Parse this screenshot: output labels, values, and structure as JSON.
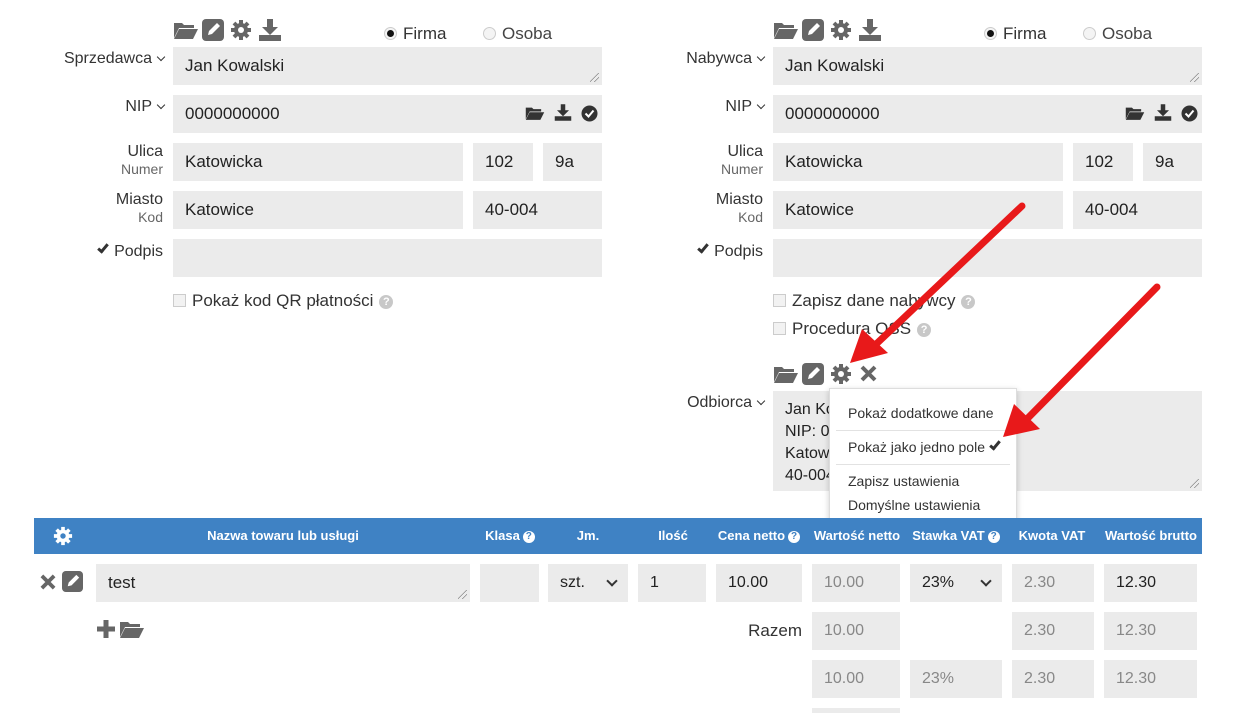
{
  "seller": {
    "label": "Sprzedawca",
    "name": "Jan Kowalski",
    "nip_label": "NIP",
    "nip": "0000000000",
    "street_label": "Ulica",
    "number_label": "Numer",
    "street": "Katowicka",
    "number": "102",
    "flat": "9a",
    "city_label": "Miasto",
    "code_label": "Kod",
    "city": "Katowice",
    "postal_code": "40-004",
    "signature_label": "Podpis",
    "signature_checked": true,
    "qr_label": "Pokaż kod QR płatności",
    "radio_company": "Firma",
    "radio_person": "Osoba"
  },
  "buyer": {
    "label": "Nabywca",
    "name": "Jan Kowalski",
    "nip_label": "NIP",
    "nip": "0000000000",
    "street_label": "Ulica",
    "number_label": "Numer",
    "street": "Katowicka",
    "number": "102",
    "flat": "9a",
    "city_label": "Miasto",
    "code_label": "Kod",
    "city": "Katowice",
    "postal_code": "40-004",
    "signature_label": "Podpis",
    "signature_checked": true,
    "save_buyer_label": "Zapisz dane nabywcy",
    "oss_label": "Procedura OSS",
    "radio_company": "Firma",
    "radio_person": "Osoba"
  },
  "recipient": {
    "label": "Odbiorca",
    "lines": [
      "Jan Ko",
      "NIP: 0",
      "Katow",
      "40-004"
    ]
  },
  "settings_menu": {
    "items": [
      {
        "label": "Pokaż dodatkowe dane",
        "checked": false
      },
      {
        "label": "Pokaż jako jedno pole",
        "checked": true
      },
      {
        "label": "Zapisz ustawienia",
        "checked": false
      },
      {
        "label": "Domyślne ustawienia",
        "checked": false
      }
    ]
  },
  "table": {
    "headers": {
      "name": "Nazwa towaru lub usługi",
      "class": "Klasa",
      "unit": "Jm.",
      "qty": "Ilość",
      "net_price": "Cena netto",
      "net_value": "Wartość netto",
      "vat_rate": "Stawka VAT",
      "vat_amount": "Kwota VAT",
      "gross_value": "Wartość brutto"
    },
    "row": {
      "name": "test",
      "class": "",
      "unit": "szt.",
      "qty": "1",
      "net_price": "10.00",
      "net_value": "10.00",
      "vat_rate": "23%",
      "vat_amount": "2.30",
      "gross_value": "12.30"
    },
    "total_label": "Razem",
    "total": {
      "net_value": "10.00",
      "vat_amount": "2.30",
      "gross_value": "12.30"
    },
    "vat_summary": {
      "net_value": "10.00",
      "vat_rate": "23%",
      "vat_amount": "2.30",
      "gross_value": "12.30"
    }
  },
  "colors": {
    "header_bg": "#3f82c4",
    "arrow": "#e8191a",
    "field_bg": "#ebebeb"
  }
}
